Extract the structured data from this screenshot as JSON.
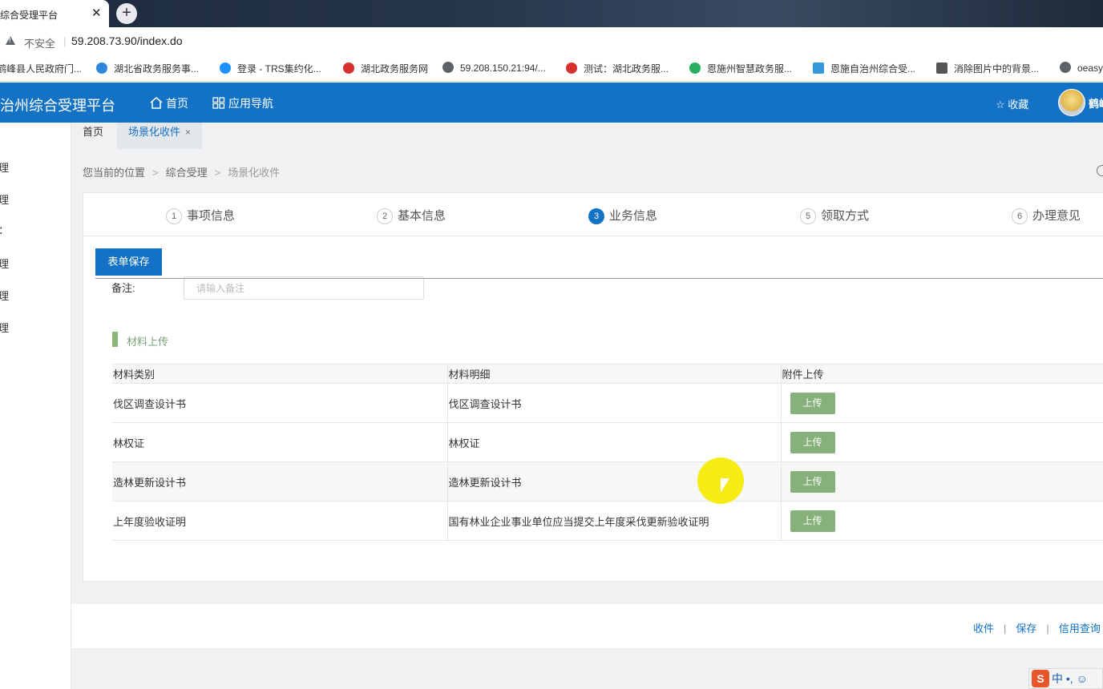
{
  "browser": {
    "tab_title": "综合受理平台",
    "tab_close": "✕",
    "new_tab": "+",
    "security_label": "不安全",
    "url_separator": "|",
    "url": "59.208.73.90/index.do",
    "bookmarks": [
      {
        "label": "鹤峰县人民政府门...",
        "icon_color": "#c0392b"
      },
      {
        "label": "湖北省政务服务事...",
        "icon_color": "#2e86de"
      },
      {
        "label": "登录 - TRS集约化...",
        "icon_color": "#1e90ff"
      },
      {
        "label": "湖北政务服务网",
        "icon_color": "#d63031"
      },
      {
        "label": "59.208.150.21:94/...",
        "icon_color": "#5f6368"
      },
      {
        "label": "测试：湖北政务服...",
        "icon_color": "#d63031"
      },
      {
        "label": "恩施州智慧政务服...",
        "icon_color": "#27ae60"
      },
      {
        "label": "恩施自治州综合受...",
        "icon_color": "#3498db"
      },
      {
        "label": "消除图片中的背景...",
        "icon_color": "#555555"
      },
      {
        "label": "oeasy",
        "icon_color": "#5f6368"
      }
    ]
  },
  "header": {
    "app_title": "治州综合受理平台",
    "nav_home": "首页",
    "nav_apps": "应用导航",
    "favorites": "收藏",
    "user_name": "鹤峰",
    "brand_color": "#1372c5"
  },
  "sidebar": {
    "items": [
      "理",
      "理",
      "：",
      "理",
      "理",
      "理"
    ]
  },
  "page_tabs": [
    {
      "label": "首页"
    },
    {
      "label": "场景化收件",
      "close": "×"
    }
  ],
  "breadcrumb": {
    "items": [
      "您当前的位置",
      "综合受理",
      "场景化收件"
    ],
    "separator": ">"
  },
  "steps": [
    {
      "num": "1",
      "label": "事项信息"
    },
    {
      "num": "2",
      "label": "基本信息"
    },
    {
      "num": "3",
      "label": "业务信息"
    },
    {
      "num": "5",
      "label": "领取方式"
    },
    {
      "num": "6",
      "label": "办理意见"
    }
  ],
  "form": {
    "save_button": "表单保存",
    "remark_label": "备注:",
    "remark_placeholder": "请输入备注",
    "remark_value": ""
  },
  "materials": {
    "section_title": "材料上传",
    "columns": [
      "材料类别",
      "材料明细",
      "附件上传"
    ],
    "upload_label": "上传",
    "rows": [
      {
        "category": "伐区调查设计书",
        "detail": "伐区调查设计书"
      },
      {
        "category": "林权证",
        "detail": "林权证"
      },
      {
        "category": "造林更新设计书",
        "detail": "造林更新设计书"
      },
      {
        "category": "上年度验收证明",
        "detail": "国有林业企业事业单位应当提交上年度采伐更新验收证明"
      }
    ]
  },
  "footer": {
    "links": [
      "收件",
      "保存",
      "信用查询"
    ],
    "separator": "|"
  },
  "ime": {
    "logo": "S",
    "text": "中 •, ☺"
  }
}
